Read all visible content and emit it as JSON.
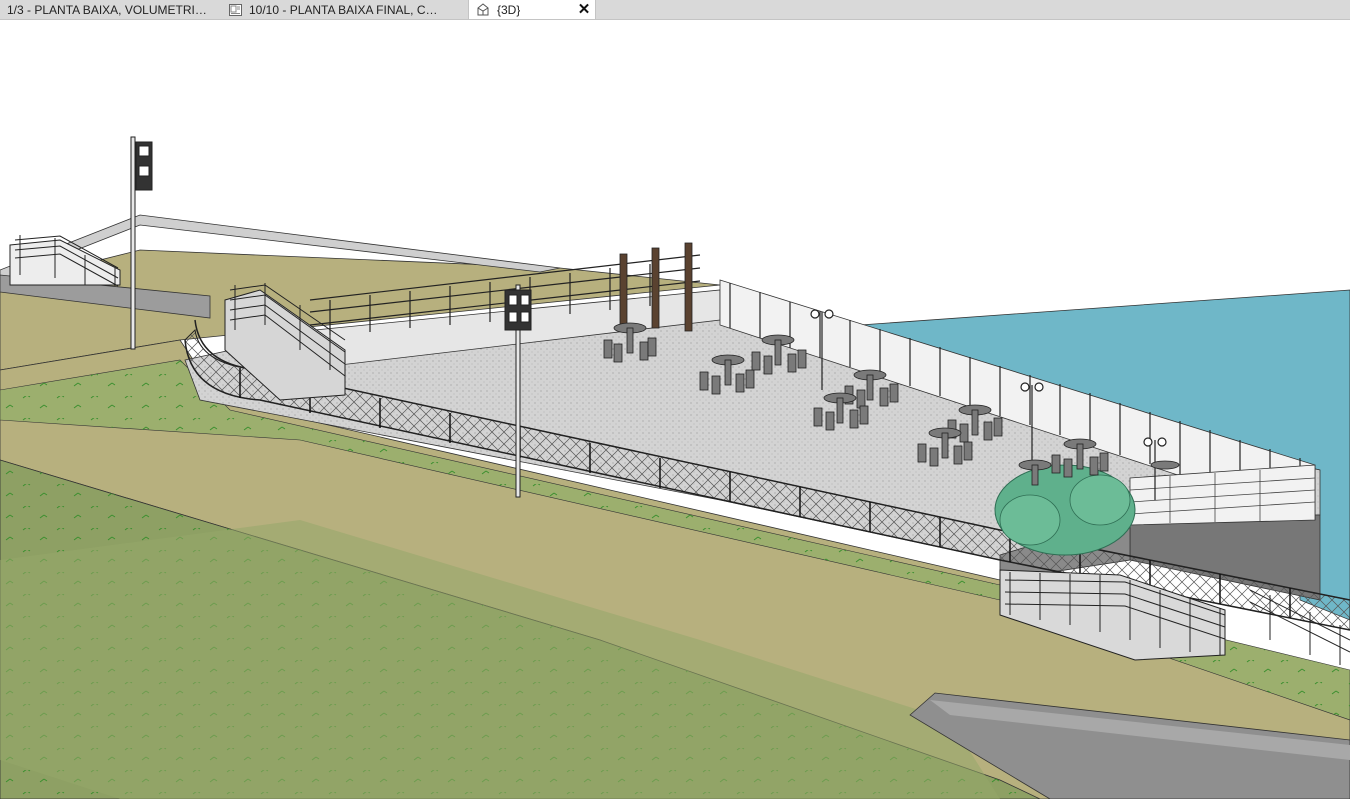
{
  "tabs": [
    {
      "label": "1/3 - PLANTA BAIXA, VOLUMETRIA...",
      "icon": "none",
      "active": false
    },
    {
      "label": "10/10 - PLANTA BAIXA FINAL, COB...",
      "icon": "sheet-icon",
      "active": false
    },
    {
      "label": "{3D}",
      "icon": "3d-view-icon",
      "active": true,
      "close_symbol": "✕"
    }
  ],
  "viewport": {
    "view": "3D model view",
    "colors": {
      "grass": "#9caf6e",
      "grass_dark": "#8ea064",
      "earth": "#b7b07e",
      "plaza": "#d4d4d4",
      "water": "#6fb7c8",
      "wall": "#e6e6e6",
      "tree": "#5fb08c"
    }
  }
}
